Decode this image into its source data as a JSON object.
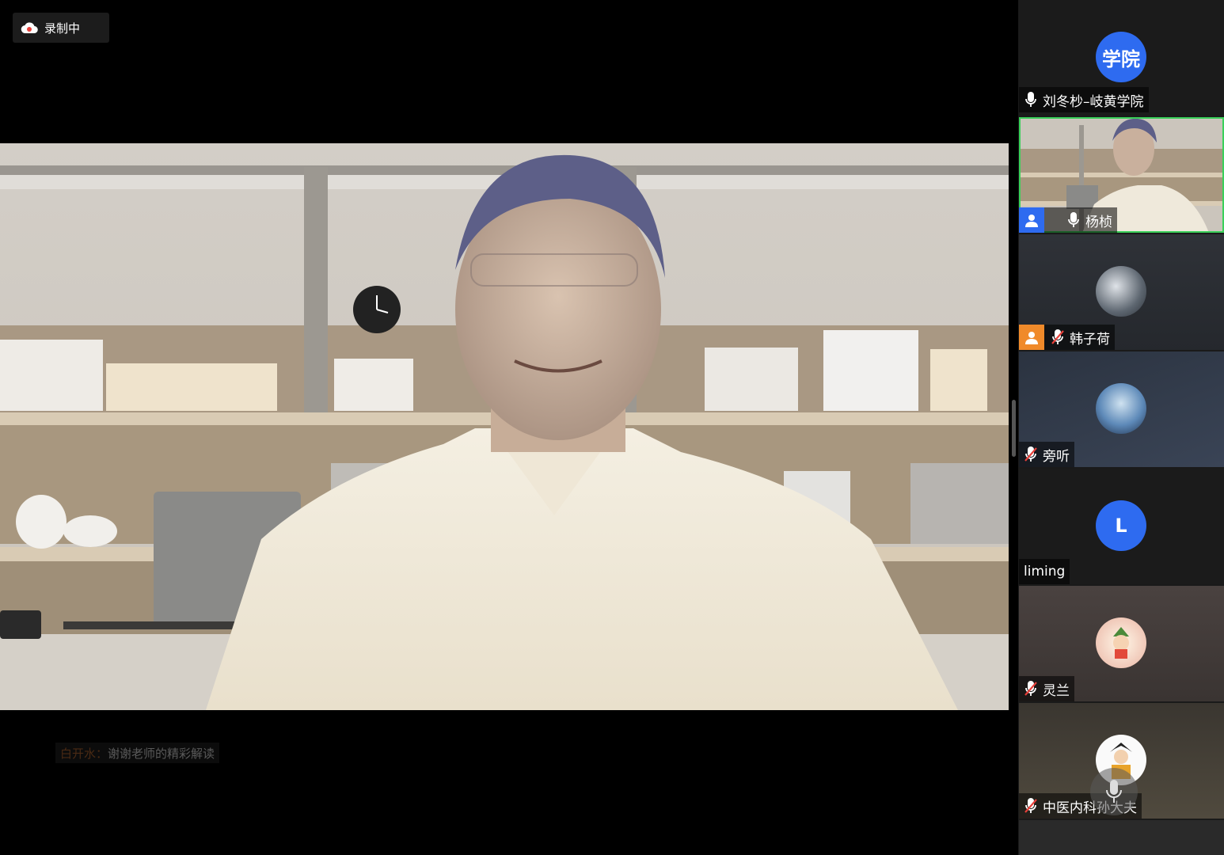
{
  "recording": {
    "label": "录制中",
    "icon": "cloud-record-icon"
  },
  "chat": {
    "sender": "白开水：",
    "text": "谢谢老师的精彩解读"
  },
  "participants": [
    {
      "name": "刘冬杪–岐黄学院",
      "avatar_text": "学院",
      "mic": "on",
      "host": false
    },
    {
      "name": "杨桢",
      "mic": "on",
      "host": true,
      "host_color": "#2e6bf0",
      "active": true
    },
    {
      "name": "韩子荷",
      "mic": "muted",
      "host": true,
      "host_color": "#f08a2a"
    },
    {
      "name": "旁听",
      "mic": "muted"
    },
    {
      "name": "liming",
      "avatar_text": "L",
      "mic": "none"
    },
    {
      "name": "灵兰",
      "mic": "muted"
    },
    {
      "name": "中医内科孙大夫",
      "mic": "muted"
    }
  ],
  "colors": {
    "active_border": "#3ad05a",
    "avatar_blue": "#2e6bf0",
    "host_orange": "#f08a2a",
    "notify_dot": "#e58a2a"
  }
}
